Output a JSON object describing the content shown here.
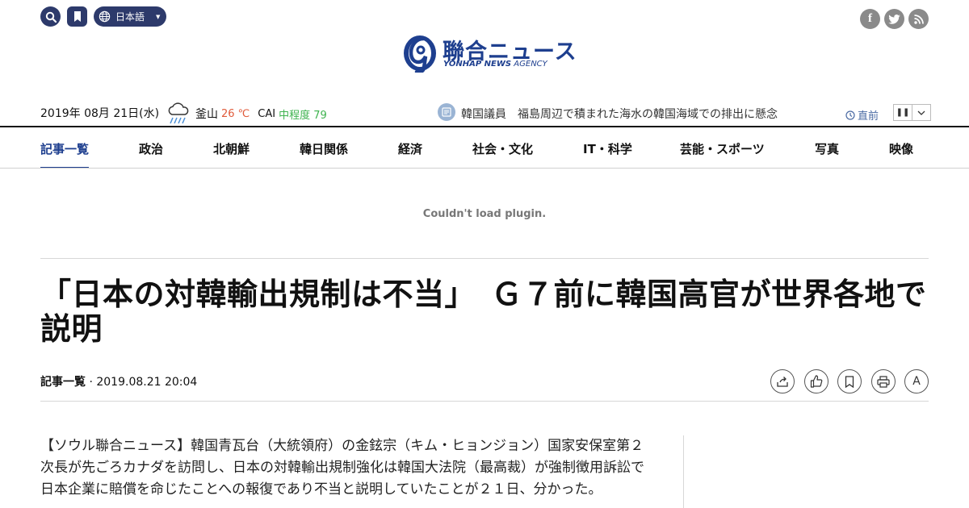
{
  "header": {
    "language": "日本語",
    "icons": {
      "search": "search-icon",
      "bookmark": "bookmark-icon",
      "globe": "globe-icon"
    },
    "social": [
      "facebook-icon",
      "twitter-icon",
      "rss-icon"
    ]
  },
  "logo": {
    "jp": "聯合ニュース",
    "en_bold": "YONHAP NEWS",
    "en_light": " AGENCY"
  },
  "infobar": {
    "date": "2019年 08月 21日(水)",
    "weather": {
      "icon": "rain-cloud-icon",
      "city": "釜山",
      "temp": "26 ℃",
      "cai_label": "CAI",
      "cai_value": "中程度 79"
    },
    "ticker": {
      "category": "韓国議員",
      "text": "福島周辺で積まれた海水の韓国海域での排出に懸念"
    },
    "latest": "直前"
  },
  "nav": {
    "items": [
      "記事一覧",
      "政治",
      "北朝鮮",
      "韓日関係",
      "経済",
      "社会・文化",
      "IT・科学",
      "芸能・スポーツ",
      "写真",
      "映像"
    ]
  },
  "plugin_message": "Couldn't load plugin.",
  "article": {
    "title": "「日本の対韓輸出規制は不当」　Ｇ７前に韓国高官が世界各地で説明",
    "category": "記事一覧",
    "date": "2019.08.21 20:04",
    "body": "【ソウル聯合ニュース】韓国青瓦台（大統領府）の金鉉宗（キム・ヒョンジョン）国家安保室第２次長が先ごろカナダを訪問し、日本の対韓輸出規制強化は韓国大法院（最高裁）が強制徴用訴訟で日本企業に賠償を命じたことへの報復であり不当と説明していたことが２１日、分かった。"
  },
  "colors": {
    "brand": "#1e3f8f",
    "nav_dark": "#2d3a6b",
    "temp": "#e05a3a",
    "cai": "#3fb34f"
  }
}
